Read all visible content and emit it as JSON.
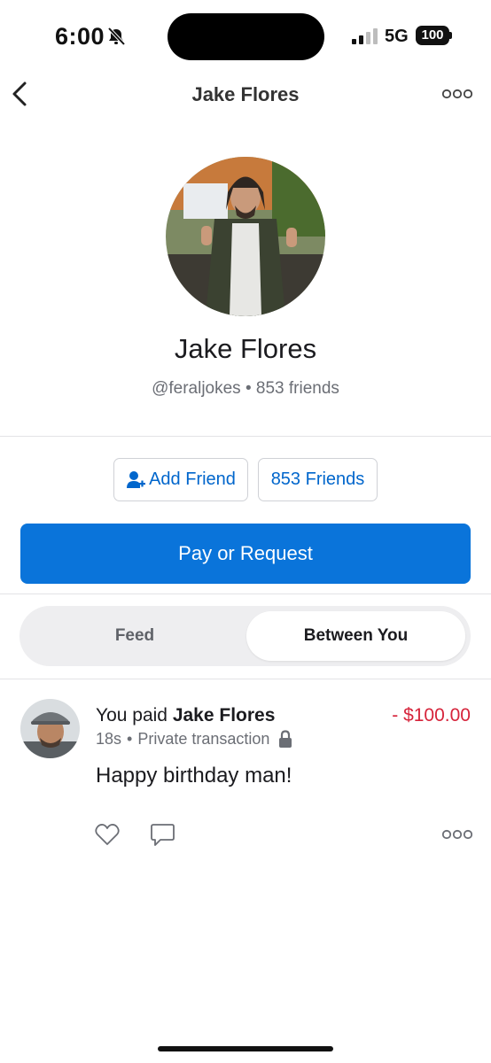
{
  "status_bar": {
    "time": "6:00",
    "network": "5G",
    "battery": "100"
  },
  "nav": {
    "title": "Jake Flores"
  },
  "profile": {
    "name": "Jake Flores",
    "username": "@feraljokes",
    "separator": "•",
    "friends_count": "853 friends"
  },
  "actions": {
    "add_friend_label": "Add Friend",
    "friends_label": "853 Friends",
    "pay_label": "Pay or Request"
  },
  "tabs": [
    {
      "label": "Feed",
      "selected": false
    },
    {
      "label": "Between You",
      "selected": true
    }
  ],
  "transaction": {
    "prefix": "You paid",
    "recipient": "Jake Flores",
    "amount": "- $100.00",
    "time": "18s",
    "separator": "•",
    "privacy": "Private transaction",
    "message": "Happy birthday man!"
  },
  "colors": {
    "primary_blue": "#0a74da",
    "link_blue": "#0066cc",
    "amount_red": "#d6243b"
  }
}
